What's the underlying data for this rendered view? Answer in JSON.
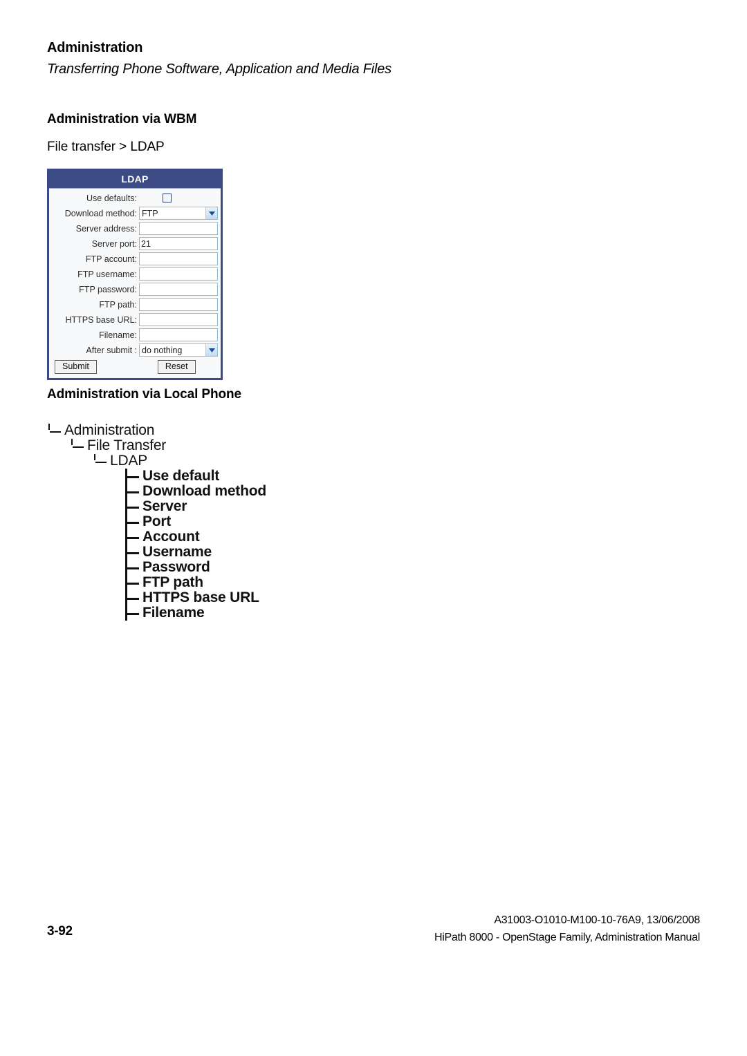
{
  "page": {
    "section_title": "Administration",
    "section_subtitle": "Transferring Phone Software, Application and Media Files",
    "page_number": "3-92"
  },
  "wbm": {
    "heading": "Administration via WBM",
    "breadcrumb": "File transfer > LDAP"
  },
  "ldap_form": {
    "title": "LDAP",
    "fields": [
      {
        "label": "Use defaults:",
        "type": "checkbox",
        "value": "",
        "checked": false
      },
      {
        "label": "Download method:",
        "type": "select",
        "value": "FTP"
      },
      {
        "label": "Server address:",
        "type": "text",
        "value": ""
      },
      {
        "label": "Server port:",
        "type": "text",
        "value": "21"
      },
      {
        "label": "FTP account:",
        "type": "text",
        "value": ""
      },
      {
        "label": "FTP username:",
        "type": "text",
        "value": ""
      },
      {
        "label": "FTP password:",
        "type": "text",
        "value": ""
      },
      {
        "label": "FTP path:",
        "type": "text",
        "value": ""
      },
      {
        "label": "HTTPS base URL:",
        "type": "text",
        "value": ""
      },
      {
        "label": "Filename:",
        "type": "text",
        "value": ""
      },
      {
        "label": "After submit :",
        "type": "select",
        "value": "do nothing"
      }
    ],
    "submit_label": "Submit",
    "reset_label": "Reset"
  },
  "local_phone": {
    "heading": "Administration via Local Phone",
    "tree": [
      {
        "level": 1,
        "label": "Administration"
      },
      {
        "level": 2,
        "label": "File Transfer"
      },
      {
        "level": 3,
        "label": "LDAP"
      },
      {
        "level": 4,
        "label": "Use default"
      },
      {
        "level": 4,
        "label": "Download method"
      },
      {
        "level": 4,
        "label": "Server"
      },
      {
        "level": 4,
        "label": "Port"
      },
      {
        "level": 4,
        "label": "Account"
      },
      {
        "level": 4,
        "label": "Username"
      },
      {
        "level": 4,
        "label": "Password"
      },
      {
        "level": 4,
        "label": "FTP path"
      },
      {
        "level": 4,
        "label": "HTTPS base URL"
      },
      {
        "level": 4,
        "label": "Filename"
      }
    ]
  },
  "footer": {
    "doc_id": "A31003-O1010-M100-10-76A9, 13/06/2008",
    "doc_title": "HiPath 8000 - OpenStage Family, Administration Manual"
  },
  "colors": {
    "titlebar": "#3d4b85",
    "widget_border": "#3a4a88",
    "input_border": "#8fbdd8",
    "checkbox_border": "#2f3f7d"
  }
}
